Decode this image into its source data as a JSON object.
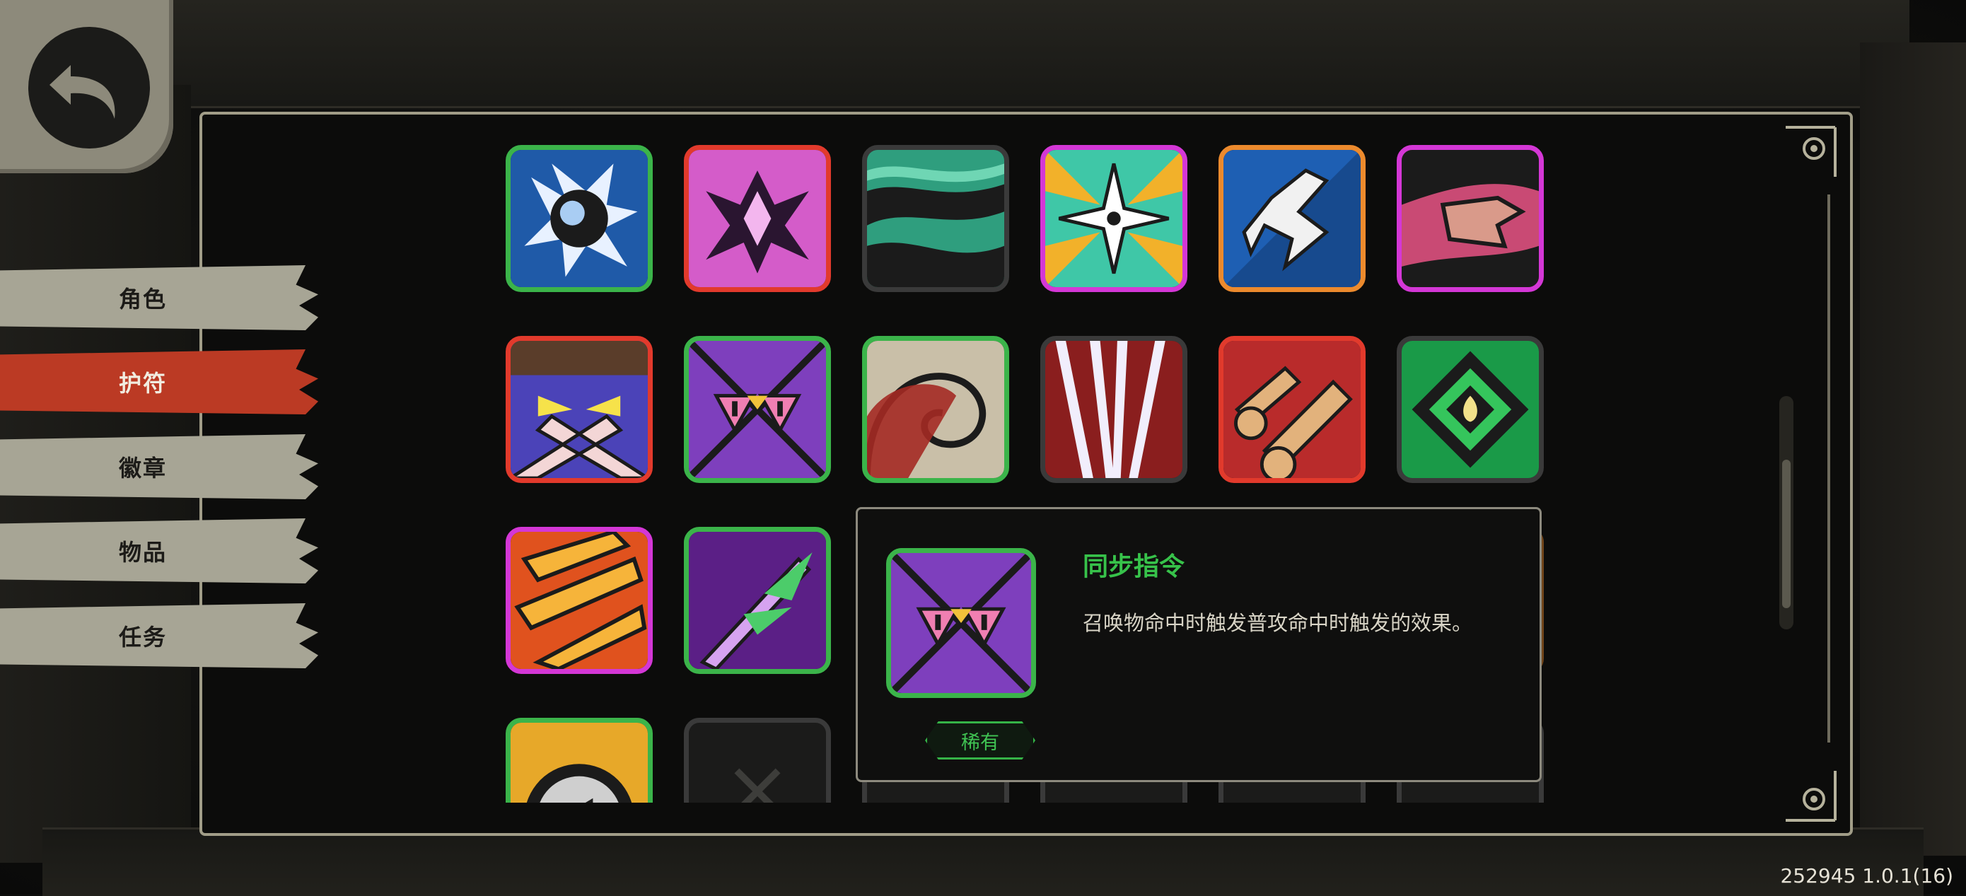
{
  "sidebar": {
    "tabs": [
      {
        "label": "角色",
        "active": false
      },
      {
        "label": "护符",
        "active": true
      },
      {
        "label": "徽章",
        "active": false
      },
      {
        "label": "物品",
        "active": false
      },
      {
        "label": "任务",
        "active": false
      }
    ]
  },
  "grid": {
    "items": [
      {
        "icon": "cloud-burst-icon",
        "rarity_color": "#3bb44a"
      },
      {
        "icon": "pink-crest-icon",
        "rarity_color": "#e23a2c"
      },
      {
        "icon": "green-wave-icon",
        "rarity_color": "#3a3a3a"
      },
      {
        "icon": "star-burst-icon",
        "rarity_color": "#d437d6"
      },
      {
        "icon": "running-figure-icon",
        "rarity_color": "#ec8a2d"
      },
      {
        "icon": "pointing-fist-icon",
        "rarity_color": "#d437d6"
      },
      {
        "icon": "masked-face-icon",
        "rarity_color": "#e23a2c"
      },
      {
        "icon": "warning-triangles-icon",
        "rarity_color": "#3bb44a"
      },
      {
        "icon": "spiral-icon",
        "rarity_color": "#3bb44a"
      },
      {
        "icon": "claw-slash-icon",
        "rarity_color": "#3a3a3a"
      },
      {
        "icon": "fists-icon",
        "rarity_color": "#e23a2c"
      },
      {
        "icon": "green-diamond-flame-icon",
        "rarity_color": "#3a3a3a"
      },
      {
        "icon": "fire-claws-icon",
        "rarity_color": "#d437d6"
      },
      {
        "icon": "purple-plant-icon",
        "rarity_color": "#3bb44a"
      },
      {
        "icon": "gold-medallion-icon",
        "rarity_color": "#3bb44a"
      },
      {
        "icon": "locked-slot-icon",
        "rarity_color": "#3a3a3a"
      }
    ]
  },
  "tooltip": {
    "title": "同步指令",
    "description": "召唤物命中时触发普攻命中时触发的效果。",
    "rarity": "稀有",
    "icon": "warning-triangles-icon",
    "color": "#37c24a"
  },
  "version": "252945 1.0.1(16)"
}
